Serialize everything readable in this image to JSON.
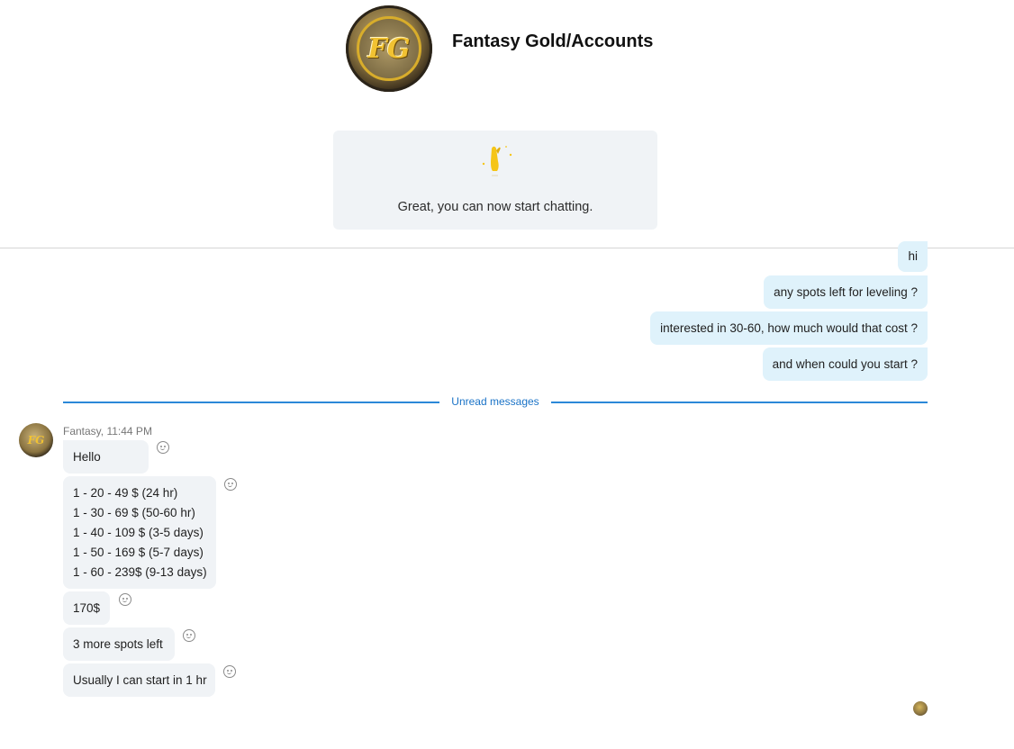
{
  "header": {
    "title": "Fantasy Gold/Accounts",
    "logo_text": "FG",
    "welcome_text": "Great, you can now start chatting.",
    "welcome_icon": "waving-hand-icon"
  },
  "outgoing": [
    {
      "text": "hi"
    },
    {
      "text": "any spots left for leveling ?"
    },
    {
      "text": "interested in 30-60, how much would that cost ?"
    },
    {
      "text": "and when could you start ?"
    }
  ],
  "unread_label": "Unread messages",
  "incoming": {
    "sender": "Fantasy, 11:44 PM",
    "messages": [
      {
        "lines": [
          "Hello"
        ]
      },
      {
        "lines": [
          "1 - 20 - 49 $ (24 hr)",
          "1 - 30 - 69 $ (50-60 hr)",
          "1 - 40 - 109 $ (3-5 days)",
          "1 - 50 - 169 $ (5-7 days)",
          "1 - 60 - 239$ (9-13 days)"
        ]
      },
      {
        "lines": [
          "170$"
        ]
      },
      {
        "lines": [
          "3 more spots left"
        ]
      },
      {
        "lines": [
          "Usually I can start in 1 hr"
        ]
      }
    ]
  },
  "colors": {
    "outgoing_bubble": "#dff2fb",
    "incoming_bubble": "#f0f3f6",
    "unread_accent": "#2b88d8"
  }
}
